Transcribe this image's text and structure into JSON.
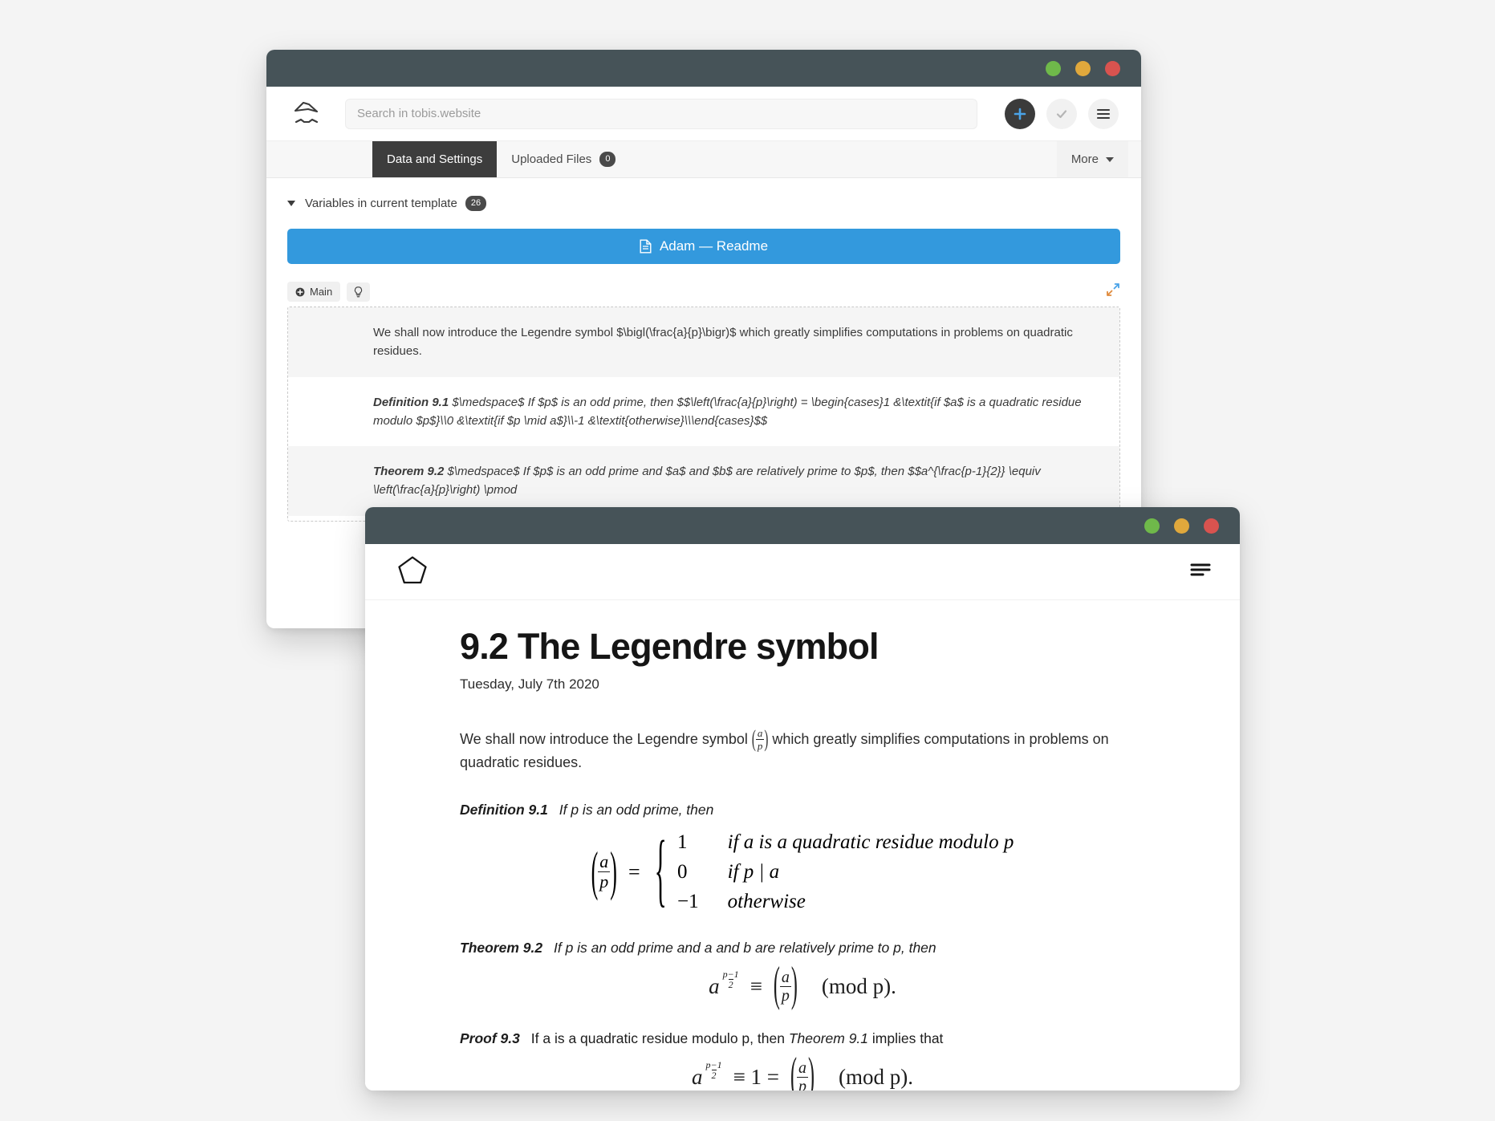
{
  "app": {
    "window_controls": [
      "minimize",
      "maximize",
      "close"
    ],
    "control_colors": {
      "green": "#6fb94a",
      "amber": "#e0a83c",
      "red": "#d9534f"
    },
    "titlebar_color": "#465358",
    "accent_blue": "#3399dd"
  },
  "editor": {
    "logo_icon": "tobis-logo-icon",
    "search": {
      "placeholder": "Search in tobis.website",
      "value": ""
    },
    "actions": [
      {
        "name": "add-button",
        "icon": "plus-icon"
      },
      {
        "name": "confirm-button",
        "icon": "check-icon"
      },
      {
        "name": "menu-button",
        "icon": "hamburger-icon"
      }
    ],
    "tabs": [
      {
        "label": "Data and Settings",
        "badge": "",
        "active": true
      },
      {
        "label": "Uploaded Files",
        "badge": "0",
        "active": false
      }
    ],
    "more_label": "More",
    "variables": {
      "label": "Variables in current template",
      "count": "26"
    },
    "readme_button": {
      "label": "Adam — Readme",
      "icon": "document-icon"
    },
    "section_chips": [
      {
        "label": "Main",
        "icon": "plus-circle-icon"
      },
      {
        "label": "",
        "icon": "lightbulb-icon"
      }
    ],
    "expand_icon": "expand-arrows-icon",
    "source_blocks": [
      {
        "kind": "paragraph",
        "shaded": true,
        "text": "We shall now introduce the Legendre symbol $\\bigl(\\frac{a}{p}\\bigr)$ which greatly simplifies computations in problems on quadratic residues."
      },
      {
        "kind": "definition",
        "shaded": false,
        "label": "Definition 9.1",
        "text": "$\\medspace$ If $p$ is an odd prime, then $$\\left(\\frac{a}{p}\\right) = \\begin{cases}1 &\\textit{if $a$ is a quadratic residue modulo $p$}\\\\0 &\\textit{if $p \\mid a$}\\\\-1 &\\textit{otherwise}\\\\\\end{cases}$$"
      },
      {
        "kind": "theorem",
        "shaded": true,
        "label": "Theorem 9.2",
        "text": "$\\medspace$ If $p$ is an odd prime and $a$ and $b$ are relatively prime to $p$, then $$a^{\\frac{p-1}{2}} \\equiv \\left(\\frac{a}{p}\\right) \\pmod"
      }
    ]
  },
  "page": {
    "logo_icon": "pentagon-logo-icon",
    "menu_icon": "hamburger-icon",
    "title": "9.2 The Legendre symbol",
    "date": "Tuesday, July 7th 2020",
    "intro_pre": "We shall now introduce the Legendre symbol",
    "intro_post": "which greatly simplifies computations in problems on quadratic residues.",
    "definition": {
      "label": "Definition 9.1",
      "text": "If p is an odd prime, then",
      "cases": [
        {
          "value": "1",
          "condition": "if a is a quadratic residue modulo p"
        },
        {
          "value": "0",
          "condition": "if p | a"
        },
        {
          "value": "−1",
          "condition": "otherwise"
        }
      ]
    },
    "theorem": {
      "label": "Theorem 9.2",
      "text": "If p is an odd prime and a and b are relatively prime to p, then",
      "equation": {
        "base": "a",
        "exponent": "p−1/2",
        "relation": "≡",
        "legendre": "a/p",
        "mod": "(mod p)."
      }
    },
    "proof": {
      "label": "Proof 9.3",
      "text_pre": "If a is a quadratic residue modulo p, then",
      "ref": "Theorem 9.1",
      "text_post": "implies that",
      "equation": {
        "base": "a",
        "exponent": "p−1/2",
        "relation": "≡ 1 =",
        "legendre": "a/p",
        "mod": "(mod p)."
      }
    },
    "math_tokens": {
      "a": "a",
      "p": "p",
      "one": "1",
      "zero": "0",
      "minus_one": "−1"
    }
  }
}
